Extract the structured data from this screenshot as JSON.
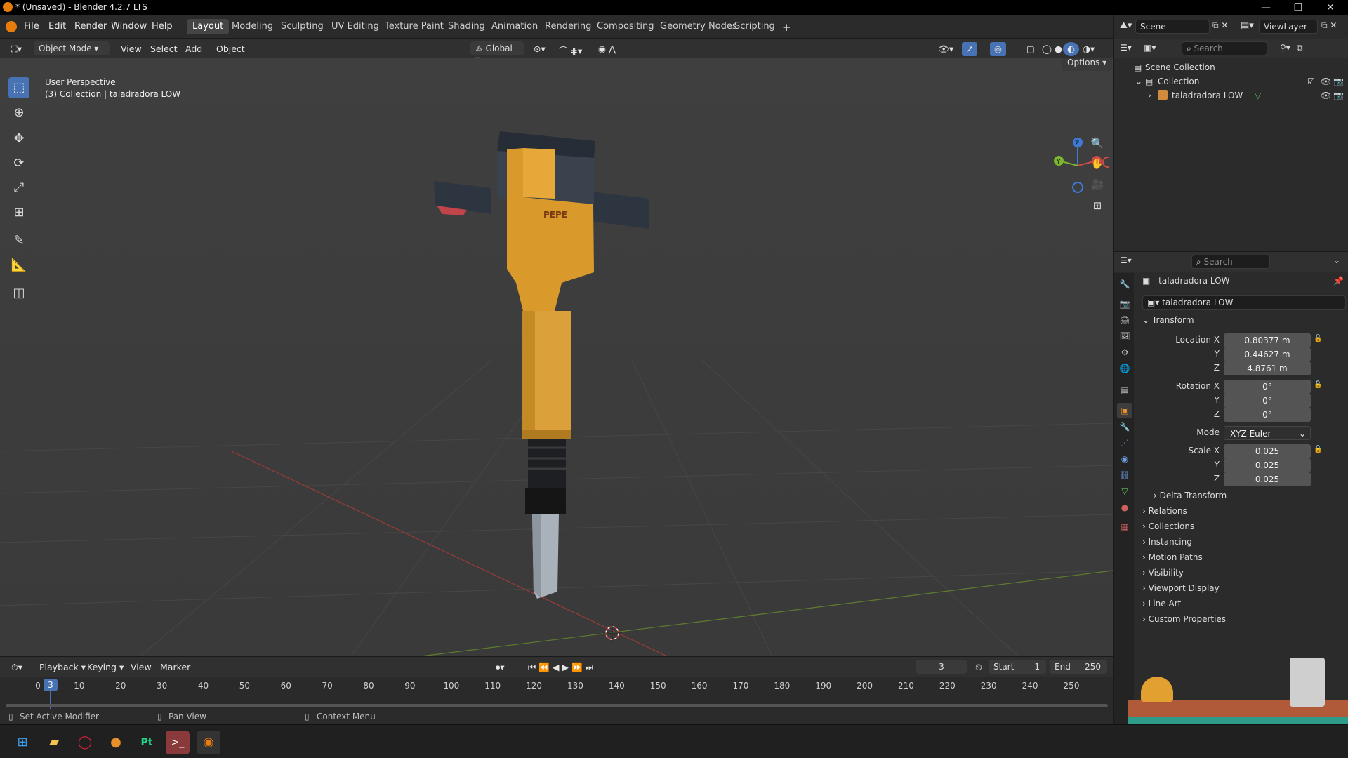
{
  "window": {
    "title": "* (Unsaved) - Blender 4.2.7 LTS"
  },
  "menus": [
    "File",
    "Edit",
    "Render",
    "Window",
    "Help"
  ],
  "workspaces": [
    "Layout",
    "Modeling",
    "Sculpting",
    "UV Editing",
    "Texture Paint",
    "Shading",
    "Animation",
    "Rendering",
    "Compositing",
    "Geometry Nodes",
    "Scripting"
  ],
  "active_workspace": "Layout",
  "scene": {
    "label": "Scene",
    "view_layer": "ViewLayer"
  },
  "viewport_header": {
    "mode": "Object Mode",
    "view": "View",
    "select": "Select",
    "add": "Add",
    "object": "Object",
    "orientation": "Global",
    "options": "Options"
  },
  "viewport": {
    "perspective": "User Perspective",
    "collection_info": "(3) Collection | taladradora LOW",
    "model_logo": "PEPE",
    "gizmo": {
      "x": "X",
      "y": "Y",
      "z": "Z"
    }
  },
  "outliner": {
    "search_placeholder": "Search",
    "scene_collection": "Scene Collection",
    "collection": "Collection",
    "object": "taladradora LOW"
  },
  "properties": {
    "search_placeholder": "Search",
    "object_name": "taladradora LOW",
    "object_field": "taladradora LOW",
    "transform_label": "Transform",
    "location_label": "Location X",
    "location": [
      "0.80377 m",
      "0.44627 m",
      "4.8761 m"
    ],
    "rotation_label": "Rotation X",
    "rotation": [
      "0°",
      "0°",
      "0°"
    ],
    "mode_label": "Mode",
    "mode_value": "XYZ Euler",
    "scale_label": "Scale X",
    "scale": [
      "0.025",
      "0.025",
      "0.025"
    ],
    "y_label": "Y",
    "z_label": "Z",
    "delta_transform": "Delta Transform",
    "panels": [
      "Relations",
      "Collections",
      "Instancing",
      "Motion Paths",
      "Visibility",
      "Viewport Display",
      "Line Art",
      "Custom Properties"
    ]
  },
  "timeline": {
    "playback": "Playback",
    "keying": "Keying",
    "view": "View",
    "marker": "Marker",
    "current_frame": "3",
    "start_label": "Start",
    "start": "1",
    "end_label": "End",
    "end": "250",
    "ticks": [
      "0",
      "10",
      "20",
      "30",
      "40",
      "50",
      "60",
      "70",
      "80",
      "90",
      "100",
      "110",
      "120",
      "130",
      "140",
      "150",
      "160",
      "170",
      "180",
      "190",
      "200",
      "210",
      "220",
      "230",
      "240",
      "250"
    ],
    "frame_marker": "3"
  },
  "statusbar": {
    "left": "Set Active Modifier",
    "middle": "Pan View",
    "right": "Context Menu"
  },
  "colors": {
    "accent_blue": "#4772b3",
    "blender_orange": "#e87d0d",
    "drill_yellow": "#d99a2b"
  }
}
